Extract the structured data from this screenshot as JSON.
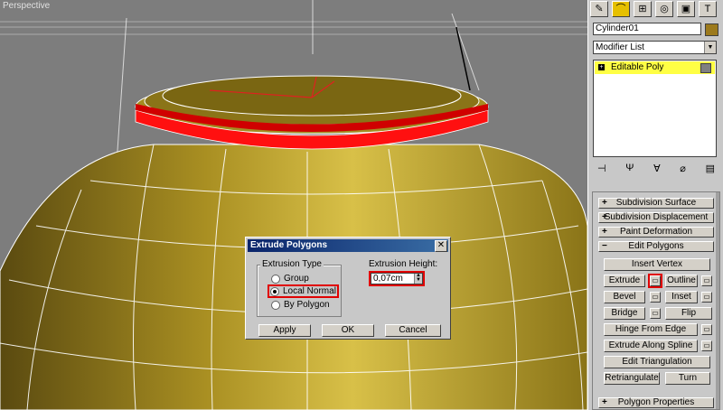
{
  "viewport": {
    "label": "Perspective",
    "colors": {
      "mesh": "#b59c20",
      "wire": "#ffffff",
      "selected": "#ff0000",
      "background": "#7d7d7d"
    }
  },
  "dialog": {
    "title": "Extrude Polygons",
    "close_label": "✕",
    "extrusion_type": {
      "label": "Extrusion Type",
      "options": [
        "Group",
        "Local Normal",
        "By Polygon"
      ],
      "selected": "Local Normal"
    },
    "extrusion_height": {
      "label": "Extrusion Height:",
      "value": "0,07cm"
    },
    "buttons": {
      "apply": "Apply",
      "ok": "OK",
      "cancel": "Cancel"
    }
  },
  "panel": {
    "tabs": [
      "create-icon",
      "modify-icon",
      "hierarchy-icon",
      "motion-icon",
      "display-icon",
      "utilities-icon"
    ],
    "object_name": "Cylinder01",
    "object_color": "#9c7a1d",
    "modifier_list": "Modifier List",
    "stack_items": [
      {
        "label": "Editable Poly",
        "expanded": "+"
      }
    ],
    "rollouts": {
      "subdivision_surface": "Subdivision Surface",
      "subdivision_displacement": "Subdivision Displacement",
      "paint_deformation": "Paint Deformation",
      "edit_polygons": "Edit Polygons",
      "polygon_properties": "Polygon Properties"
    },
    "edit_polygons": {
      "insert_vertex": "Insert Vertex",
      "extrude": "Extrude",
      "outline": "Outline",
      "bevel": "Bevel",
      "inset": "Inset",
      "bridge": "Bridge",
      "flip": "Flip",
      "hinge_from_edge": "Hinge From Edge",
      "extrude_along_spline": "Extrude Along Spline",
      "edit_triangulation": "Edit Triangulation",
      "retriangulate": "Retriangulate",
      "turn": "Turn"
    },
    "signs": {
      "plus": "+",
      "minus": "−"
    }
  }
}
